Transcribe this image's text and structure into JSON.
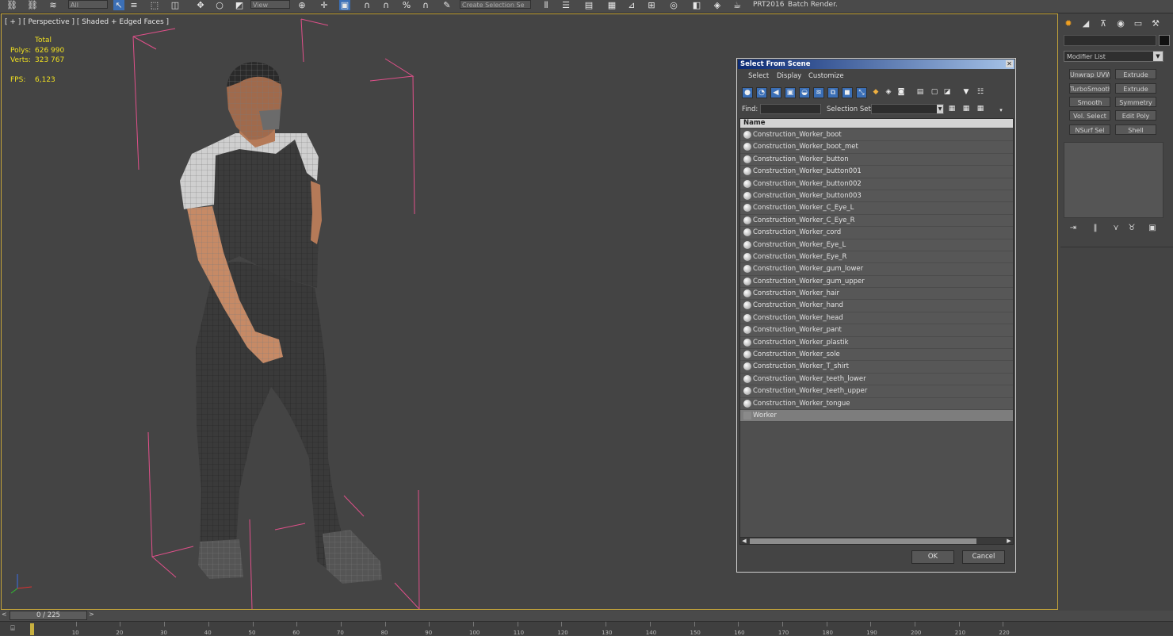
{
  "toolbar": {
    "selection_filter": "All",
    "ref_coord": "View",
    "named_sets": "Create Selection Se",
    "text_a": "PRT2016",
    "text_b": "Batch Render..."
  },
  "viewport": {
    "label": "[ + ] [ Perspective ] [ Shaded + Edged Faces ]",
    "stats": {
      "total_label": "Total",
      "polys_label": "Polys:",
      "polys_value": "626 990",
      "verts_label": "Verts:",
      "verts_value": "323 767",
      "fps_label": "FPS:",
      "fps_value": "6,123"
    }
  },
  "command_panel": {
    "modifier_list": "Modifier List",
    "modifier_buttons": [
      "Unwrap UVW",
      "Extrude",
      "TurboSmooth",
      "Extrude",
      "Smooth",
      "Symmetry",
      "Vol. Select",
      "Edit Poly",
      "NSurf Sel",
      "Shell"
    ]
  },
  "dialog": {
    "title": "Select From Scene",
    "menu": [
      "Select",
      "Display",
      "Customize"
    ],
    "find_label": "Find:",
    "selection_set_label": "Selection Set:",
    "column_header": "Name",
    "items": [
      {
        "name": "Construction_Worker_boot",
        "group": false,
        "selected": false
      },
      {
        "name": "Construction_Worker_boot_met",
        "group": false,
        "selected": false
      },
      {
        "name": "Construction_Worker_button",
        "group": false,
        "selected": false
      },
      {
        "name": "Construction_Worker_button001",
        "group": false,
        "selected": false
      },
      {
        "name": "Construction_Worker_button002",
        "group": false,
        "selected": false
      },
      {
        "name": "Construction_Worker_button003",
        "group": false,
        "selected": false
      },
      {
        "name": "Construction_Worker_C_Eye_L",
        "group": false,
        "selected": false
      },
      {
        "name": "Construction_Worker_C_Eye_R",
        "group": false,
        "selected": false
      },
      {
        "name": "Construction_Worker_cord",
        "group": false,
        "selected": false
      },
      {
        "name": "Construction_Worker_Eye_L",
        "group": false,
        "selected": false
      },
      {
        "name": "Construction_Worker_Eye_R",
        "group": false,
        "selected": false
      },
      {
        "name": "Construction_Worker_gum_lower",
        "group": false,
        "selected": false
      },
      {
        "name": "Construction_Worker_gum_upper",
        "group": false,
        "selected": false
      },
      {
        "name": "Construction_Worker_hair",
        "group": false,
        "selected": false
      },
      {
        "name": "Construction_Worker_hand",
        "group": false,
        "selected": false
      },
      {
        "name": "Construction_Worker_head",
        "group": false,
        "selected": false
      },
      {
        "name": "Construction_Worker_pant",
        "group": false,
        "selected": false
      },
      {
        "name": "Construction_Worker_plastik",
        "group": false,
        "selected": false
      },
      {
        "name": "Construction_Worker_sole",
        "group": false,
        "selected": false
      },
      {
        "name": "Construction_Worker_T_shirt",
        "group": false,
        "selected": false
      },
      {
        "name": "Construction_Worker_teeth_lower",
        "group": false,
        "selected": false
      },
      {
        "name": "Construction_Worker_teeth_upper",
        "group": false,
        "selected": false
      },
      {
        "name": "Construction_Worker_tongue",
        "group": false,
        "selected": false
      },
      {
        "name": "Worker",
        "group": true,
        "selected": true
      }
    ],
    "ok_label": "OK",
    "cancel_label": "Cancel"
  },
  "timeline": {
    "frame_display": "0 / 225",
    "ticks": [
      "10",
      "20",
      "30",
      "40",
      "50",
      "60",
      "70",
      "80",
      "90",
      "100",
      "110",
      "120",
      "130",
      "140",
      "150",
      "160",
      "170",
      "180",
      "190",
      "200",
      "210",
      "220"
    ]
  },
  "colors": {
    "accent": "#3b6fb6",
    "viewport_border": "#c4a43a",
    "stats_text": "#f0e020",
    "bbox": "#e0508a"
  }
}
